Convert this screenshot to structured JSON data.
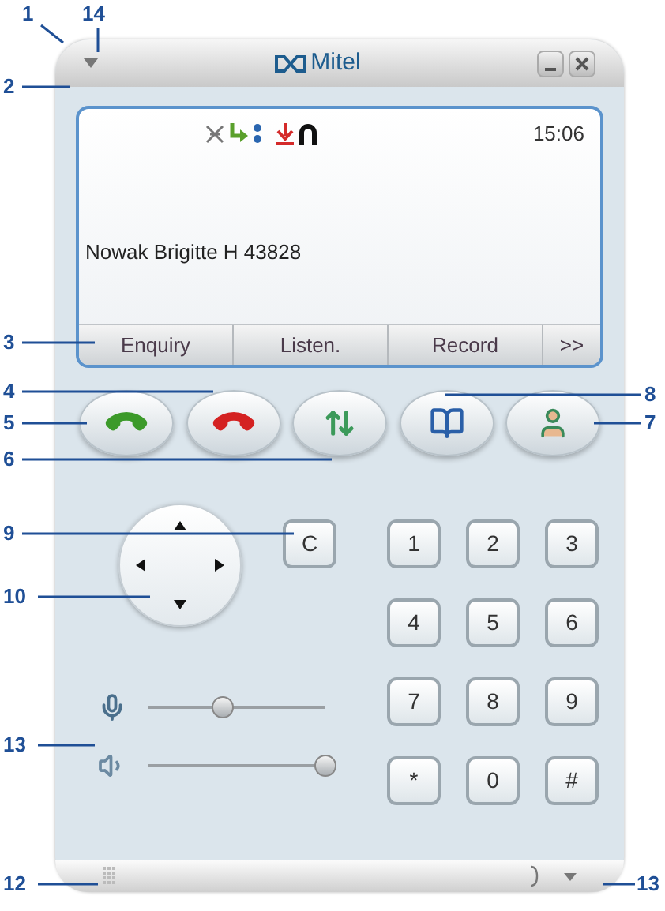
{
  "window": {
    "title": "Mitel"
  },
  "display": {
    "time": "15:06",
    "caller": "Nowak Brigitte H 43828"
  },
  "softkeys": [
    "Enquiry",
    "Listen.",
    "Record",
    ">>"
  ],
  "keypad": {
    "clear": "C",
    "keys": [
      "1",
      "2",
      "3",
      "4",
      "5",
      "6",
      "7",
      "8",
      "9",
      "*",
      "0",
      "#"
    ]
  },
  "sliders": [
    {
      "kind": "microphone",
      "level": 0.42
    },
    {
      "kind": "speaker",
      "level": 1
    }
  ],
  "callouts": [
    "1",
    "14",
    "2",
    "3",
    "4",
    "5",
    "6",
    "8",
    "7",
    "9",
    "10",
    "13",
    "12",
    "13"
  ]
}
